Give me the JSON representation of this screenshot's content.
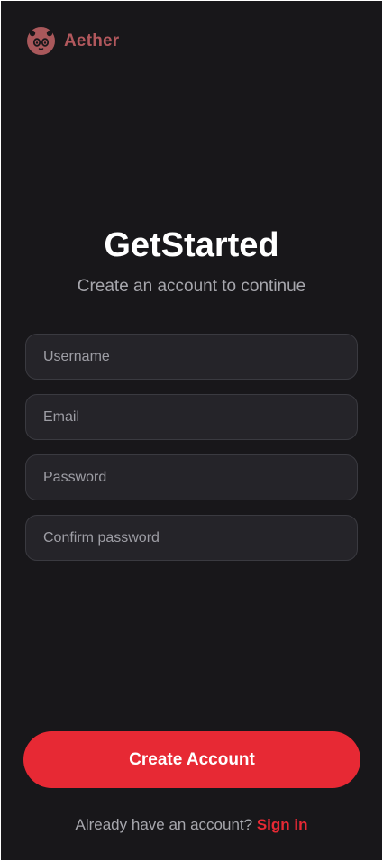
{
  "brand": {
    "name": "Aether",
    "logo_icon": "panda-face-icon",
    "logo_color": "#a9585b"
  },
  "header": {
    "title": "GetStarted",
    "subtitle": "Create an account to continue"
  },
  "form": {
    "username_placeholder": "Username",
    "username_value": "",
    "email_placeholder": "Email",
    "email_value": "",
    "password_placeholder": "Password",
    "password_value": "",
    "confirm_password_placeholder": "Confirm password",
    "confirm_password_value": ""
  },
  "actions": {
    "create_account_label": "Create Account"
  },
  "footer": {
    "prompt": "Already have an account?",
    "sign_in_label": "Sign in"
  },
  "colors": {
    "background": "#18171a",
    "accent": "#e72934",
    "field_background": "#252429",
    "muted_text": "#a7a7ad"
  }
}
